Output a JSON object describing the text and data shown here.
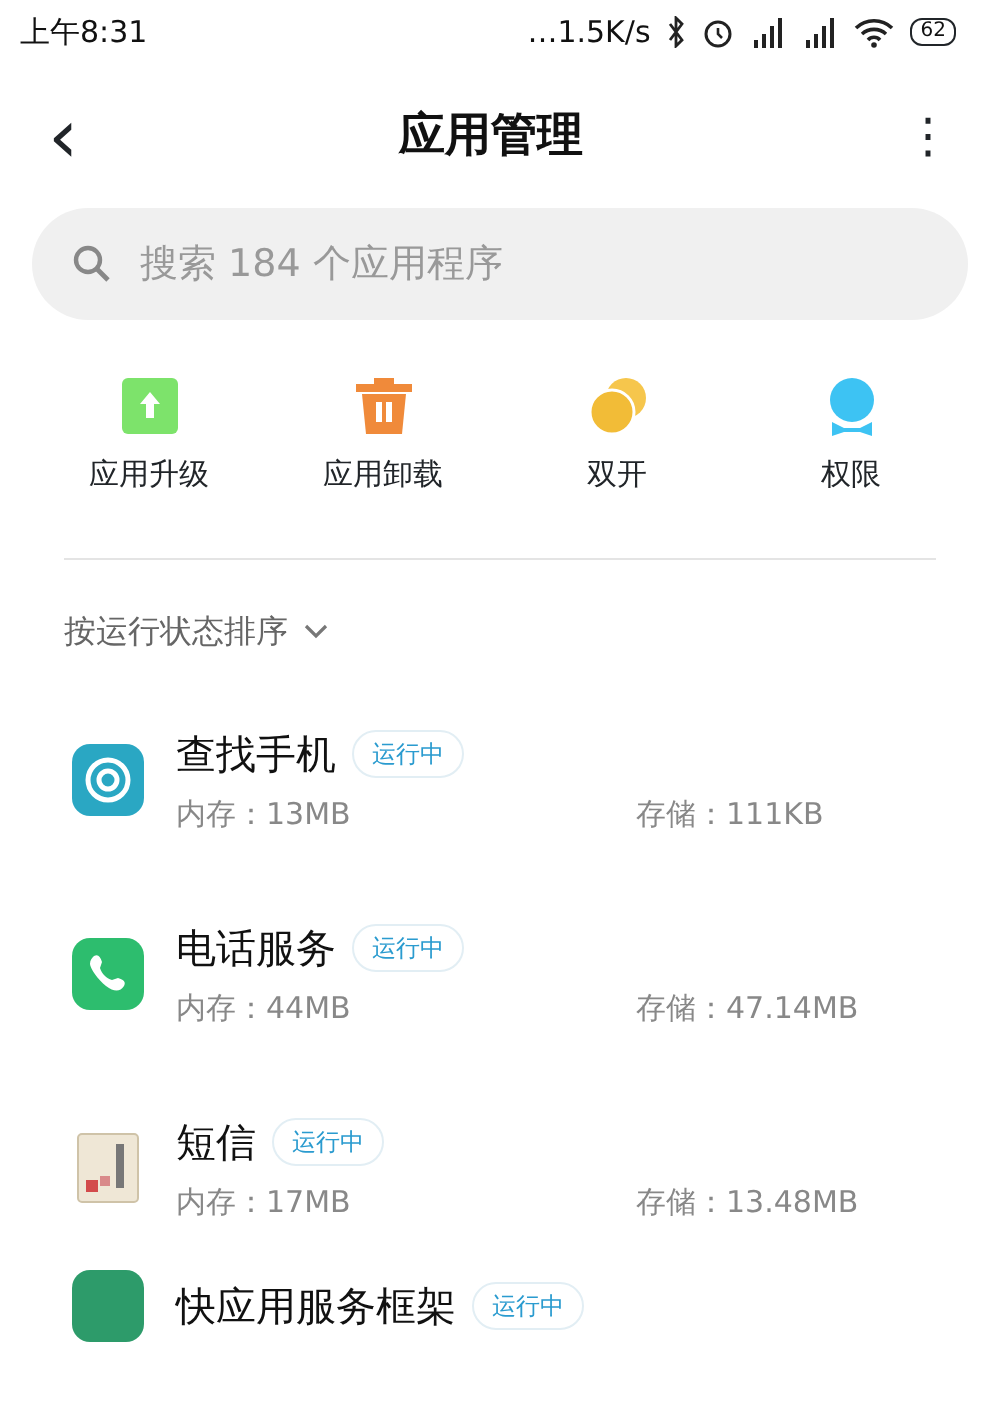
{
  "status_bar": {
    "time": "上午8:31",
    "network_speed": "…1.5K/s",
    "battery": "62"
  },
  "header": {
    "back": "‹",
    "title": "应用管理",
    "menu": "⋮"
  },
  "search": {
    "placeholder": "搜索 184 个应用程序"
  },
  "actions": [
    {
      "label": "应用升级"
    },
    {
      "label": "应用卸载"
    },
    {
      "label": "双开"
    },
    {
      "label": "权限"
    }
  ],
  "sort": {
    "label": "按运行状态排序"
  },
  "apps": [
    {
      "name": "查找手机",
      "status": "运行中",
      "memory": "内存：13MB",
      "storage": "存储：111KB"
    },
    {
      "name": "电话服务",
      "status": "运行中",
      "memory": "内存：44MB",
      "storage": "存储：47.14MB"
    },
    {
      "name": "短信",
      "status": "运行中",
      "memory": "内存：17MB",
      "storage": "存储：13.48MB"
    },
    {
      "name": "快应用服务框架",
      "status": "运行中"
    }
  ]
}
